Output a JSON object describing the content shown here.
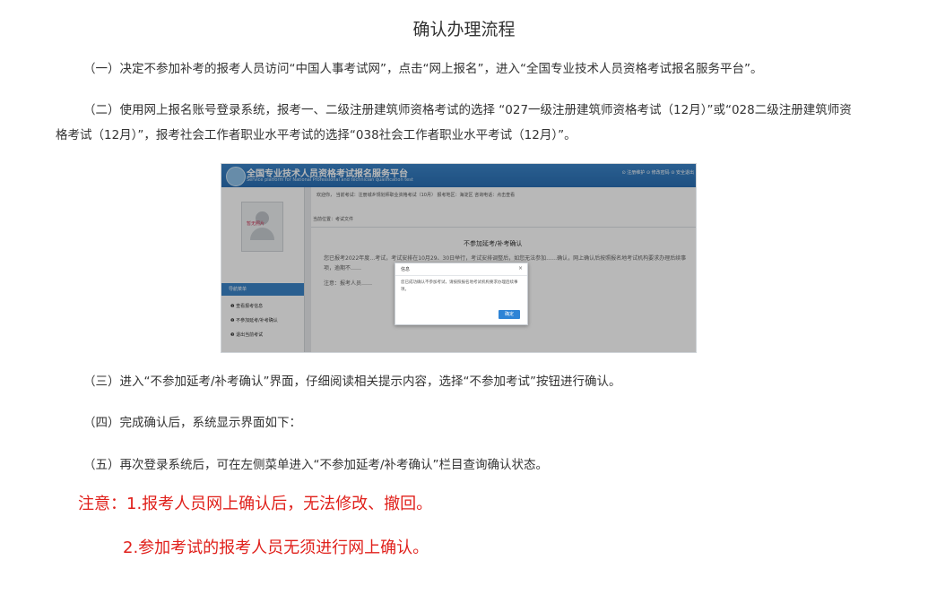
{
  "title": "确认办理流程",
  "steps": [
    "（一）决定不参加补考的报考人员访问“中国人事考试网”，点击“网上报名”，进入“全国专业技术人员资格考试报名服务平台”。",
    "（二）使用网上报名账号登录系统，报考一、二级注册建筑师资格考试的选择 “027一级注册建筑师资格考试（12月）”或“028二级注册建筑师资格考试（12月）”，报考社会工作者职业水平考试的选择“038社会工作者职业水平考试（12月）”。",
    "（三）进入“不参加延考/补考确认”界面，仔细阅读相关提示内容，选择“不参加考试”按钮进行确认。",
    "（四）完成确认后，系统显示界面如下：",
    "（五）再次登录系统后，可在左侧菜单进入“不参加延考/补考确认”栏目查询确认状态。"
  ],
  "notes": [
    "注意：1.报考人员网上确认后，无法修改、撤回。",
    "2.参加考试的报考人员无须进行网上确认。"
  ],
  "screenshot": {
    "platform_title": "全国专业技术人员资格考试报名服务平台",
    "platform_subtitle": "Service platform for National Professional and technician qualification test",
    "top_links": "⊙ 注册维护  ⊙ 修改密码  ⊙ 安全退出",
    "info_bar": "欢迎你，    当前考试：注册城乡规划师职业资格考试（10月）   报考地区：海淀区    咨询电话：点击查看",
    "breadcrumb": "当前位置：考试文件",
    "avatar_label": "暂无照片",
    "nav_header": "导航菜单",
    "nav_items": [
      "❶ 查看报考信息",
      "❷ 不参加延考/补考确认",
      "❸ 退出当前考试"
    ],
    "heading": "不参加延考/补考确认",
    "body_text": "您已报考2022年度…考试，考试安排在10月29、30日举行，考试安排调整后，如您无法参加……确认，网上确认后按照报名地考试机构要求办理后续事项，逾期不……",
    "note_text": "注意：报考人员……",
    "dialog": {
      "title": "信息",
      "close": "×",
      "message": "您已成功确认不参加考试，请按照报名地考试机构要求办理后续事项。",
      "button": "确定"
    }
  },
  "colors": {
    "note_red": "#e0201b",
    "header_blue": "#2a6fb4",
    "dialog_button": "#2e84d6"
  }
}
